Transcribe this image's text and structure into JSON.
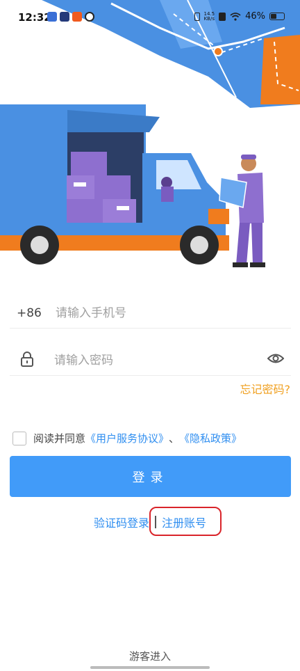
{
  "status": {
    "time": "12:32",
    "net_speed_value": "14.5",
    "net_speed_unit": "KB/s",
    "battery": "46%",
    "battery_level": 0.46
  },
  "form": {
    "country_code": "+86",
    "phone_placeholder": "请输入手机号",
    "password_placeholder": "请输入密码",
    "forgot_password": "忘记密码?",
    "agreement_prefix": "阅读并同意",
    "user_agreement": "《用户服务协议》",
    "agreement_separator": "、",
    "privacy_policy": "《隐私政策》",
    "login_button": "登录",
    "sms_login": "验证码登录",
    "register": "注册账号",
    "guest": "游客进入"
  },
  "colors": {
    "primary": "#419bf9",
    "link": "#2f8ef0",
    "forgot": "#f0a020",
    "highlight": "#d9242a",
    "truck_body": "#4a90e2",
    "truck_accent": "#f07c1e",
    "boxes": "#8e6fcf"
  },
  "icons": {
    "lock": "lock-icon",
    "eye": "eye-icon",
    "wifi": "wifi-icon",
    "battery": "battery-icon"
  }
}
